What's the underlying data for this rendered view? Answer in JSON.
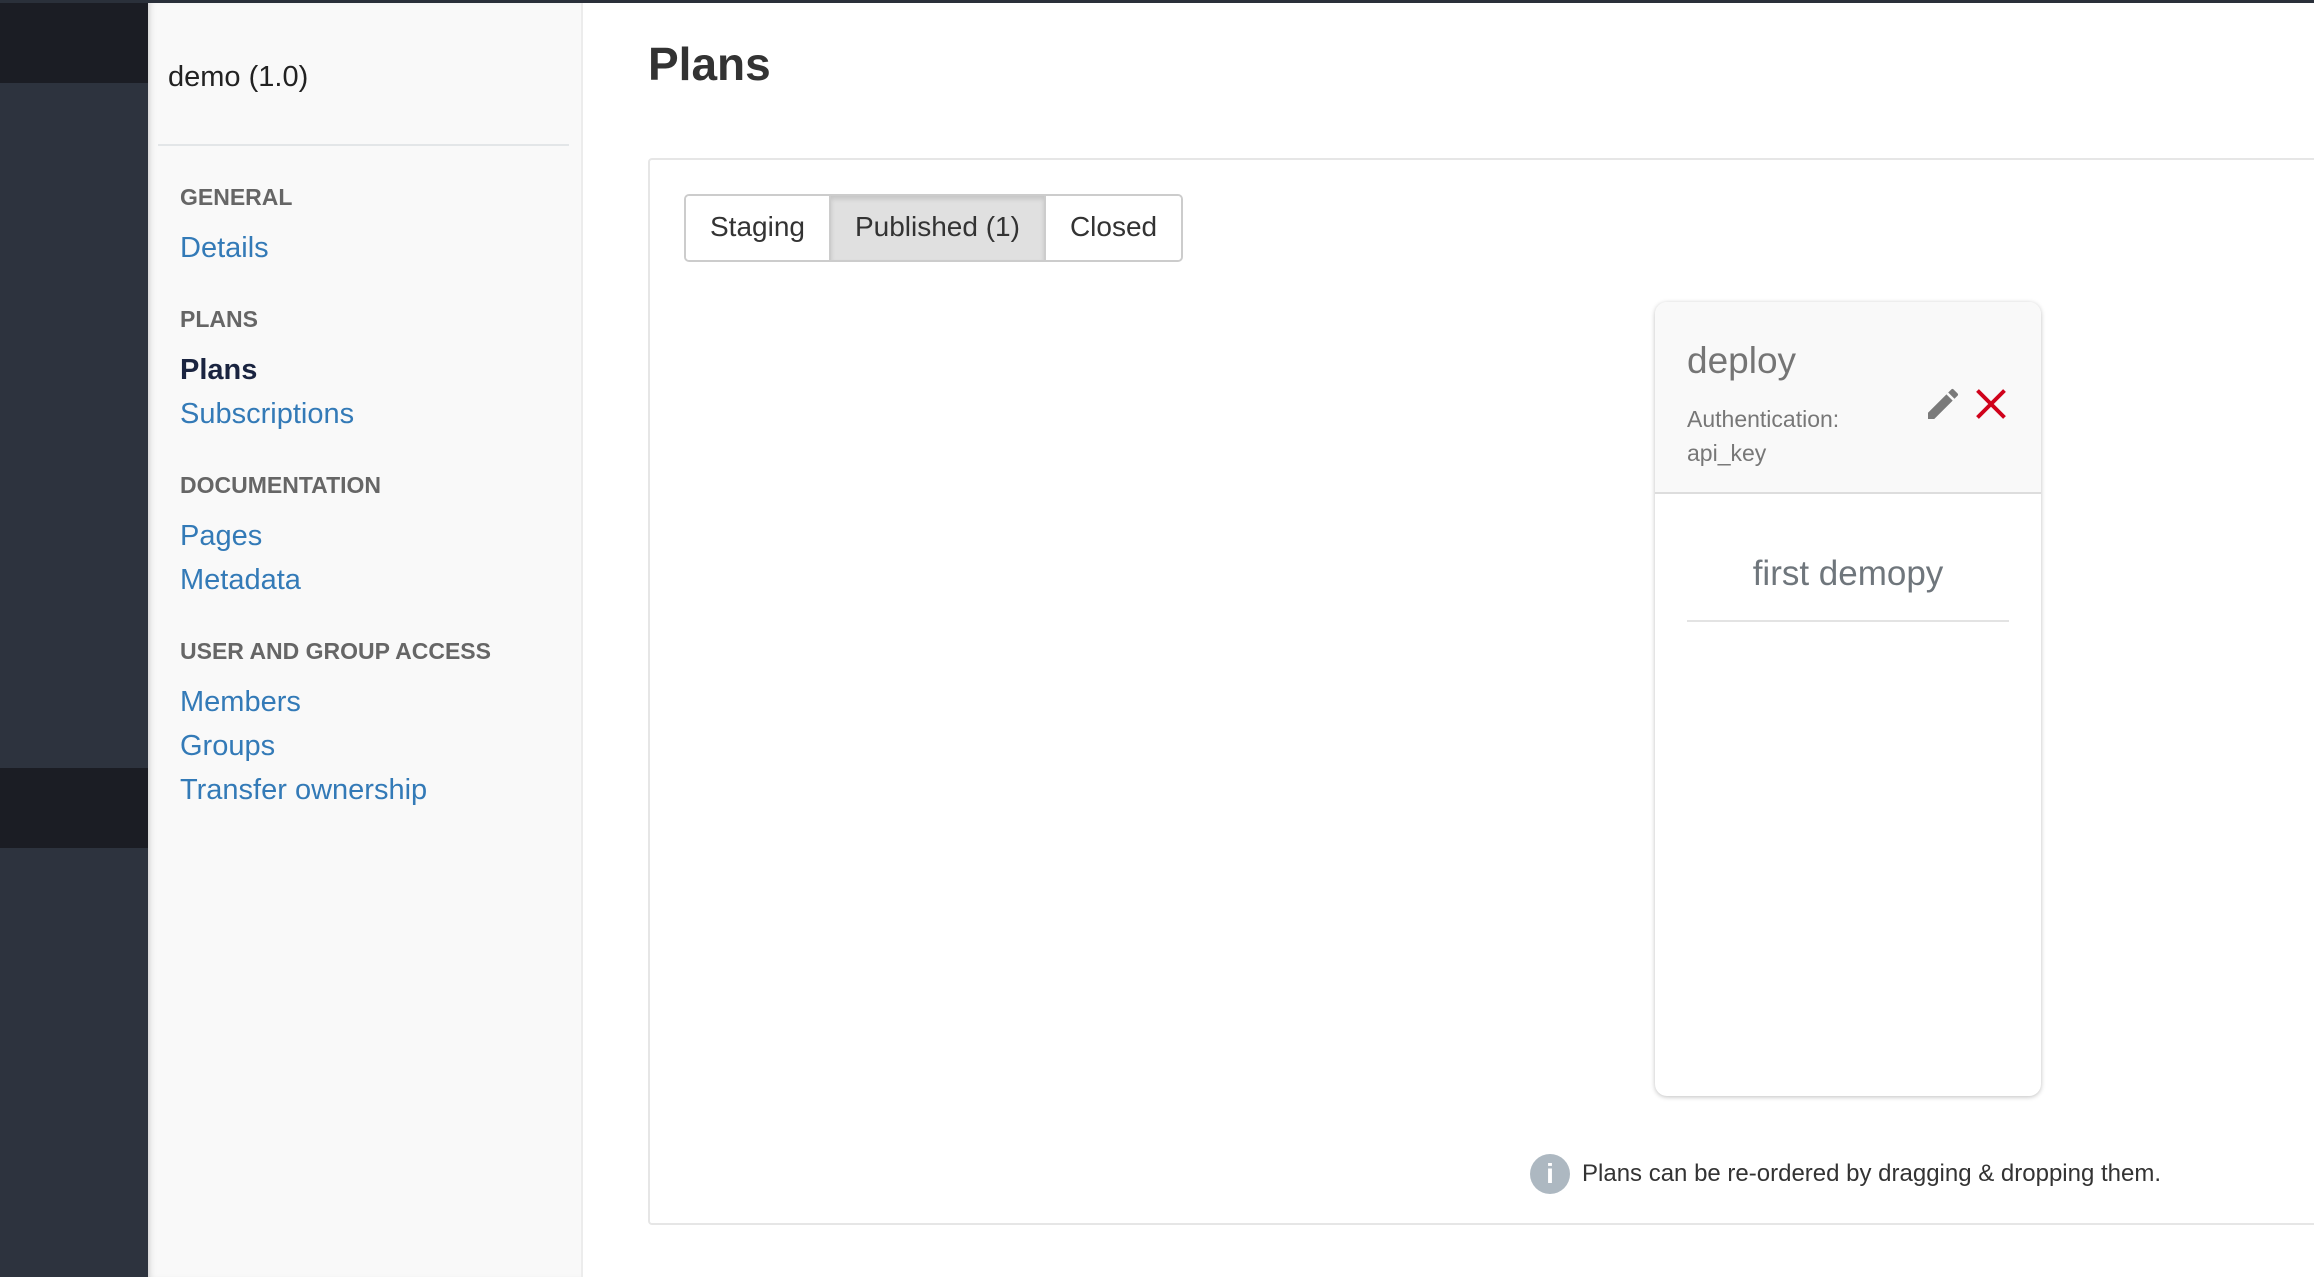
{
  "sidebar": {
    "api_name": "demo (1.0)",
    "sections": [
      {
        "title": "GENERAL",
        "items": [
          "Details"
        ]
      },
      {
        "title": "PLANS",
        "items": [
          "Plans",
          "Subscriptions"
        ]
      },
      {
        "title": "DOCUMENTATION",
        "items": [
          "Pages",
          "Metadata"
        ]
      },
      {
        "title": "USER AND GROUP ACCESS",
        "items": [
          "Members",
          "Groups",
          "Transfer ownership"
        ]
      }
    ],
    "active_item": "Plans"
  },
  "main": {
    "title": "Plans",
    "tabs": [
      {
        "label": "Staging"
      },
      {
        "label": "Published (1)",
        "active": true
      },
      {
        "label": "Closed"
      }
    ],
    "plan_card": {
      "name": "deploy",
      "auth_label": "Authentication:",
      "auth_value": "api_key",
      "plan_title": "first demopy",
      "icons": [
        "pencil-icon",
        "close-icon"
      ],
      "delete_color": "#d0021b"
    },
    "info": {
      "icon": "info-icon",
      "text": "Plans can be re-ordered by dragging & dropping them."
    }
  }
}
